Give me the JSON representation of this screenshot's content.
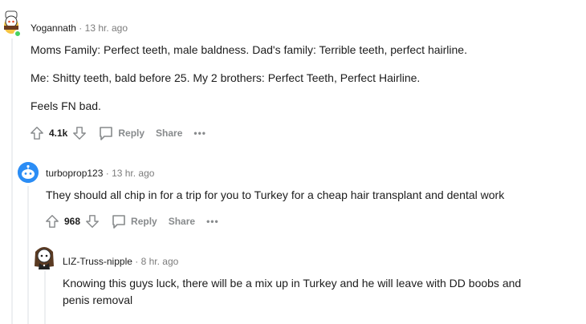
{
  "comments": [
    {
      "username": "Yogannath",
      "separator": "·",
      "time": "13 hr. ago",
      "paragraphs": [
        "Moms Family: Perfect teeth, male baldness. Dad's family: Terrible teeth, perfect hairline.",
        "Me: Shitty teeth, bald before 25. My 2 brothers: Perfect Teeth, Perfect Hairline.",
        "Feels FN bad."
      ],
      "votes": "4.1k",
      "reply_label": "Reply",
      "share_label": "Share",
      "more_label": "•••"
    },
    {
      "username": "turboprop123",
      "separator": "·",
      "time": "13 hr. ago",
      "paragraphs": [
        "They should all chip in for a trip for you to Turkey for a cheap hair transplant and dental work"
      ],
      "votes": "968",
      "reply_label": "Reply",
      "share_label": "Share",
      "more_label": "•••"
    },
    {
      "username": "LIZ-Truss-nipple",
      "separator": "·",
      "time": "8 hr. ago",
      "paragraphs": [
        "Knowing this guys luck, there will be a mix up in Turkey and he will leave with DD boobs and penis removal"
      ]
    }
  ],
  "colors": {
    "online": "#46d160",
    "upvote": "#878a8c",
    "thread": "#edeff1",
    "avatar_blue": "#2b8df5"
  }
}
